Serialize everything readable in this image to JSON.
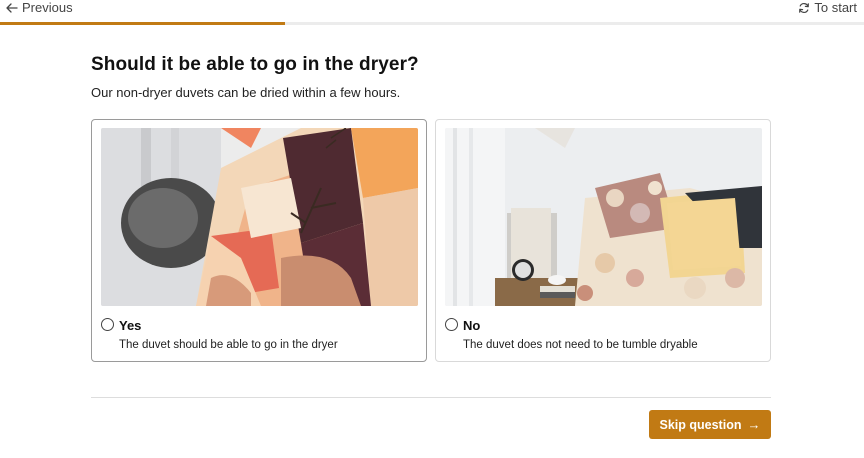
{
  "nav": {
    "previous_label": "Previous",
    "previous_icon": "arrow-left-icon",
    "start_label": "To start",
    "start_icon": "refresh-icon"
  },
  "progress": {
    "fraction": 0.33,
    "color": "#c17a14"
  },
  "question": {
    "title": "Should it be able to go in the dryer?",
    "subtitle": "Our non-dryer duvets can be dried within a few hours."
  },
  "options": [
    {
      "label": "Yes",
      "description": "The duvet should be able to go in the dryer",
      "selected": false
    },
    {
      "label": "No",
      "description": "The duvet does not need to be tumble dryable",
      "selected": false
    }
  ],
  "footer": {
    "skip_label": "Skip question",
    "skip_icon": "arrow-right-icon"
  },
  "colors": {
    "accent": "#c17a14"
  }
}
